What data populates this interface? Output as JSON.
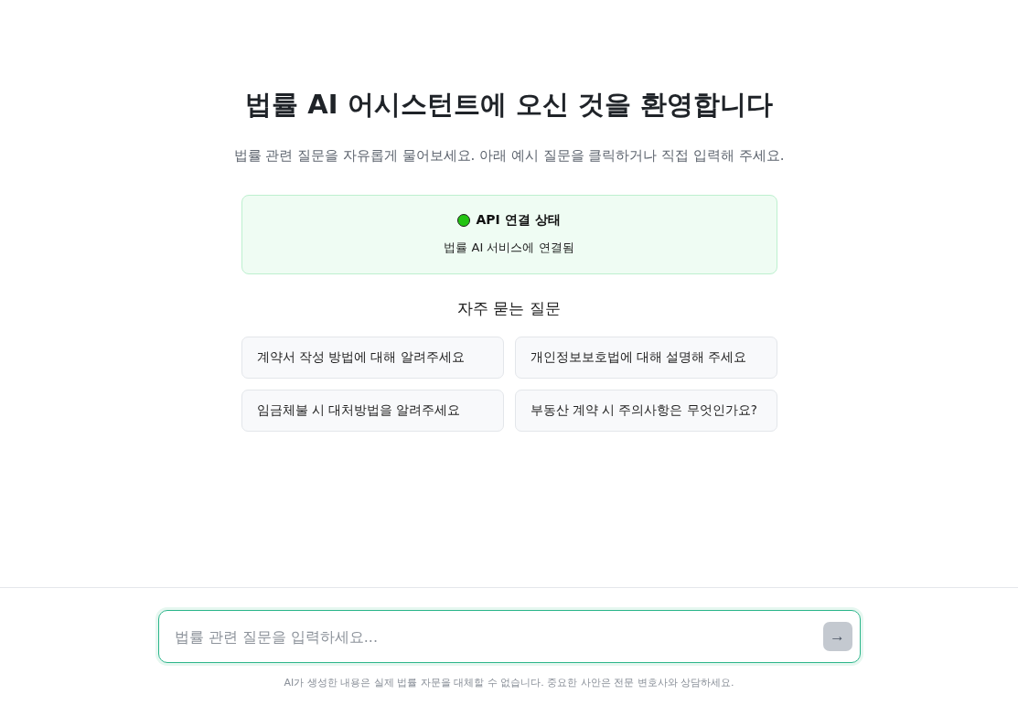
{
  "welcome": {
    "title": "법률 AI 어시스턴트에 오신 것을 환영합니다",
    "subtitle": "법률 관련 질문을 자유롭게 물어보세요. 아래 예시 질문을 클릭하거나 직접 입력해 주세요."
  },
  "api_status": {
    "title": "API 연결 상태",
    "message": "법률 AI 서비스에 연결됨",
    "color": "#22c412"
  },
  "faq": {
    "heading": "자주 묻는 질문",
    "questions": [
      "계약서 작성 방법에 대해 알려주세요",
      "개인정보보호법에 대해 설명해 주세요",
      "임금체불 시 대처방법을 알려주세요",
      "부동산 계약 시 주의사항은 무엇인가요?"
    ]
  },
  "composer": {
    "placeholder": "법률 관련 질문을 입력하세요...",
    "send_button": {
      "label": "→",
      "disabled": true
    },
    "disclaimer": "AI가 생성한 내용은 실제 법률 자문을 대체할 수 없습니다. 중요한 사안은 전문 변호사와 상담하세요."
  }
}
